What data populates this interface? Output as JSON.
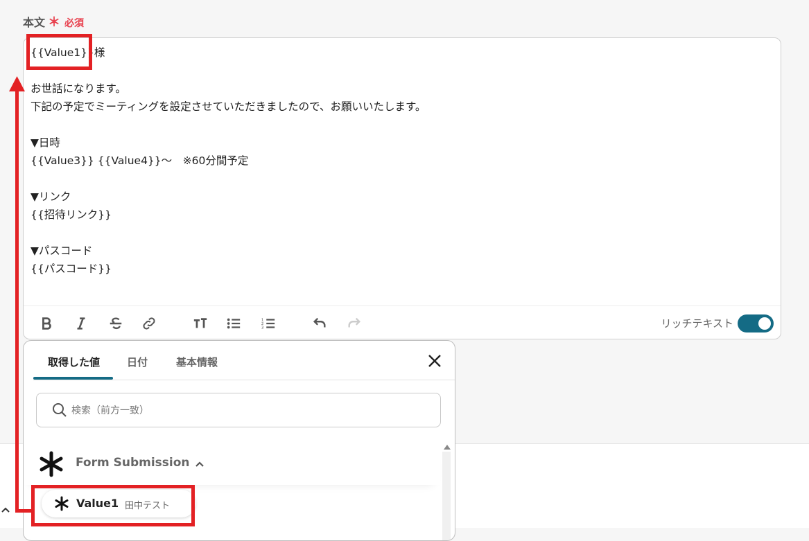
{
  "field": {
    "label": "本文",
    "required_mark": "＊",
    "required_text": "必須"
  },
  "editor": {
    "lines": [
      "{{Value1}}様",
      "",
      "お世話になります。",
      "下記の予定でミーティングを設定させていただきましたので、お願いいたします。",
      "",
      "▼日時",
      "{{Value3}} {{Value4}}～　※60分間予定",
      "",
      "▼リンク",
      "{{招待リンク}}",
      "",
      "▼パスコード",
      "{{パスコード}}"
    ],
    "toolbar": {
      "icons": [
        "bold-icon",
        "italic-icon",
        "strikethrough-icon",
        "link-icon",
        "text-size-icon",
        "bullet-list-icon",
        "numbered-list-icon",
        "undo-icon",
        "redo-icon"
      ],
      "rich_text_label": "リッチテキスト",
      "rich_text_enabled": true
    }
  },
  "panel": {
    "tabs": [
      {
        "label": "取得した値",
        "active": true
      },
      {
        "label": "日付",
        "active": false
      },
      {
        "label": "基本情報",
        "active": false
      }
    ],
    "search_placeholder": "検索（前方一致）",
    "group": {
      "title": "Form Submission",
      "expanded": true
    },
    "items": [
      {
        "name": "Value1",
        "value": "田中テスト"
      }
    ]
  },
  "colors": {
    "accent": "#146b85",
    "required": "#e8424f",
    "annotation": "#e32124"
  }
}
